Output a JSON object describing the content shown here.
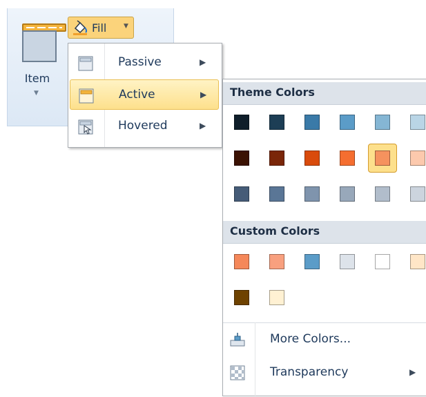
{
  "ribbon": {
    "item_label": "Item",
    "fill_label": "Fill"
  },
  "fill_menu": {
    "items": [
      {
        "label": "Passive",
        "icon": "passive-fill-icon"
      },
      {
        "label": "Active",
        "icon": "active-fill-icon"
      },
      {
        "label": "Hovered",
        "icon": "hovered-fill-icon"
      }
    ],
    "highlighted_item": "Active"
  },
  "color_panel": {
    "theme_header": "Theme Colors",
    "custom_header": "Custom Colors",
    "theme_rows": [
      [
        "#0f1e2a",
        "#1d3e55",
        "#3a7aa8",
        "#5b9cc8",
        "#85b6d4",
        "#b9d5e6"
      ],
      [
        "#3b1203",
        "#7a2608",
        "#d94b0c",
        "#f56e30",
        "#f5925e",
        "#fcc9ad"
      ],
      [
        "#465c78",
        "#5a7696",
        "#7f94ad",
        "#98a8ba",
        "#b1bdcb",
        "#ccd4de"
      ]
    ],
    "selected_theme_color": "#f5925e",
    "custom_rows": [
      [
        "#f5885a",
        "#f8a07f",
        "#5b9cc8",
        "#dde3ea",
        "#ffffff",
        "#ffe6c7"
      ],
      [
        "#6e4200",
        "#fff1d3"
      ]
    ],
    "actions": [
      {
        "label": "More Colors...",
        "icon": "more-colors-icon",
        "submenu": false
      },
      {
        "label": "Transparency",
        "icon": "transparency-icon",
        "submenu": true
      }
    ]
  }
}
